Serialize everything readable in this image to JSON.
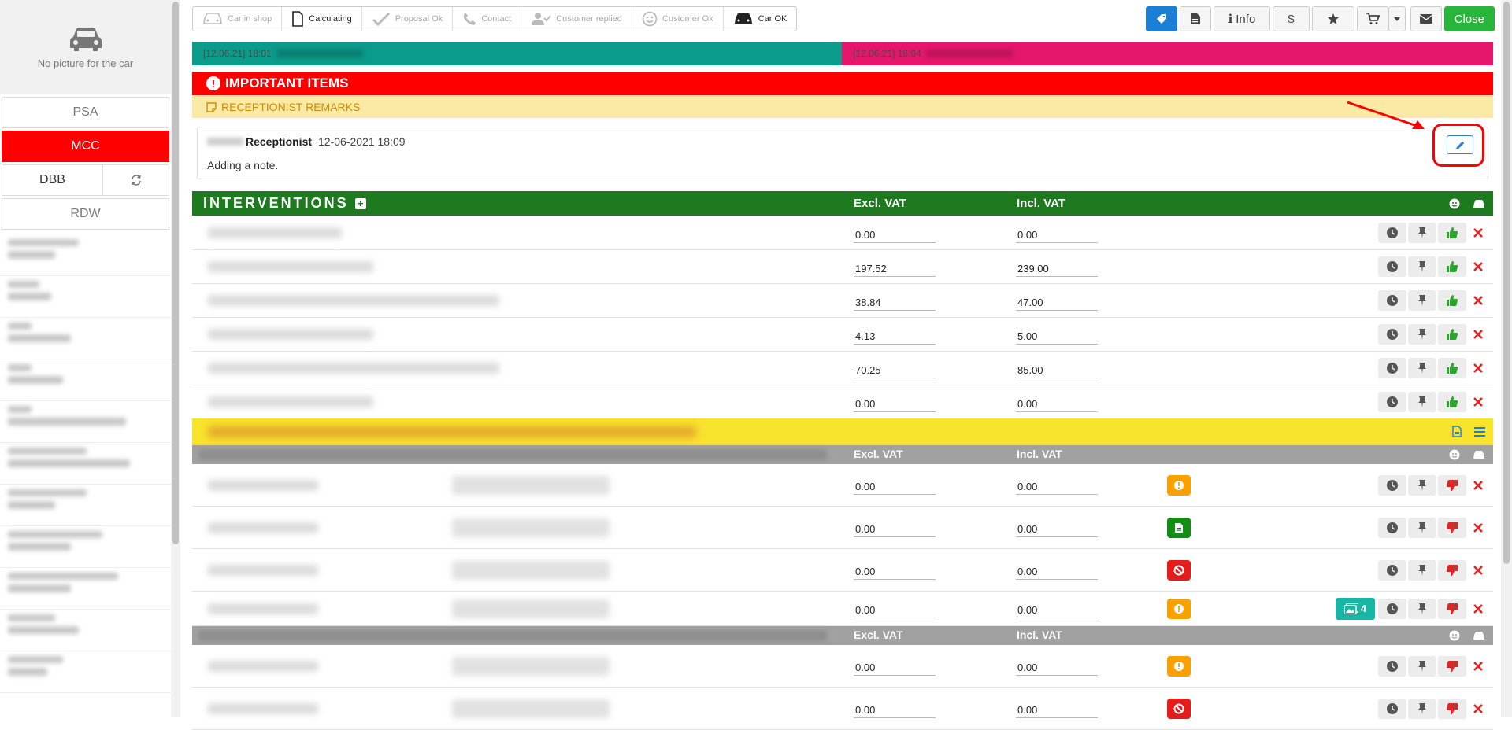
{
  "sidebar": {
    "no_picture": "No picture for the car",
    "buttons": {
      "psa": "PSA",
      "mcc": "MCC",
      "dbb": "DBB",
      "rdw": "RDW"
    }
  },
  "steps": [
    {
      "label": "Car in shop",
      "icon": "car-icon",
      "state": "pending"
    },
    {
      "label": "Calculating",
      "icon": "document-icon",
      "state": "done"
    },
    {
      "label": "Proposal Ok",
      "icon": "check-icon",
      "state": "pending"
    },
    {
      "label": "Contact",
      "icon": "phone-icon",
      "state": "pending"
    },
    {
      "label": "Customer replied",
      "icon": "user-check-icon",
      "state": "pending"
    },
    {
      "label": "Customer Ok",
      "icon": "smile-icon",
      "state": "pending"
    },
    {
      "label": "Car OK",
      "icon": "car-icon",
      "state": "done"
    }
  ],
  "toolbar": {
    "info": "Info",
    "dollar": "$",
    "close": "Close"
  },
  "timeline": {
    "seg1": "[12.06.21] 18:01",
    "seg2": "[12.06.21] 18:04"
  },
  "important": {
    "title": "IMPORTANT ITEMS",
    "remarks": "RECEPTIONIST REMARKS"
  },
  "note": {
    "role": "Receptionist",
    "date": "12-06-2021 18:09",
    "text": "Adding a note."
  },
  "interventions": {
    "title": "INTERVENTIONS",
    "excl_vat": "Excl. VAT",
    "incl_vat": "Incl. VAT",
    "rows": [
      {
        "excl": "0.00",
        "incl": "0.00"
      },
      {
        "excl": "197.52",
        "incl": "239.00"
      },
      {
        "excl": "38.84",
        "incl": "47.00"
      },
      {
        "excl": "4.13",
        "incl": "5.00"
      },
      {
        "excl": "70.25",
        "incl": "85.00"
      },
      {
        "excl": "0.00",
        "incl": "0.00"
      }
    ]
  },
  "proposal": {
    "excl_vat": "Excl. VAT",
    "incl_vat": "Incl. VAT",
    "rows": [
      {
        "excl": "0.00",
        "incl": "0.00",
        "status": "warning"
      },
      {
        "excl": "0.00",
        "incl": "0.00",
        "status": "document"
      },
      {
        "excl": "0.00",
        "incl": "0.00",
        "status": "banned"
      },
      {
        "excl": "0.00",
        "incl": "0.00",
        "status": "warning",
        "photos": "4"
      }
    ],
    "rows2": [
      {
        "excl": "0.00",
        "incl": "0.00",
        "status": "warning"
      },
      {
        "excl": "0.00",
        "incl": "0.00",
        "status": "banned"
      }
    ]
  },
  "colors": {
    "accent_red": "#ff0000",
    "green": "#1e7a1e",
    "teal": "#0b9b8a",
    "pink": "#e5176d",
    "yellow": "#f8e32d"
  }
}
